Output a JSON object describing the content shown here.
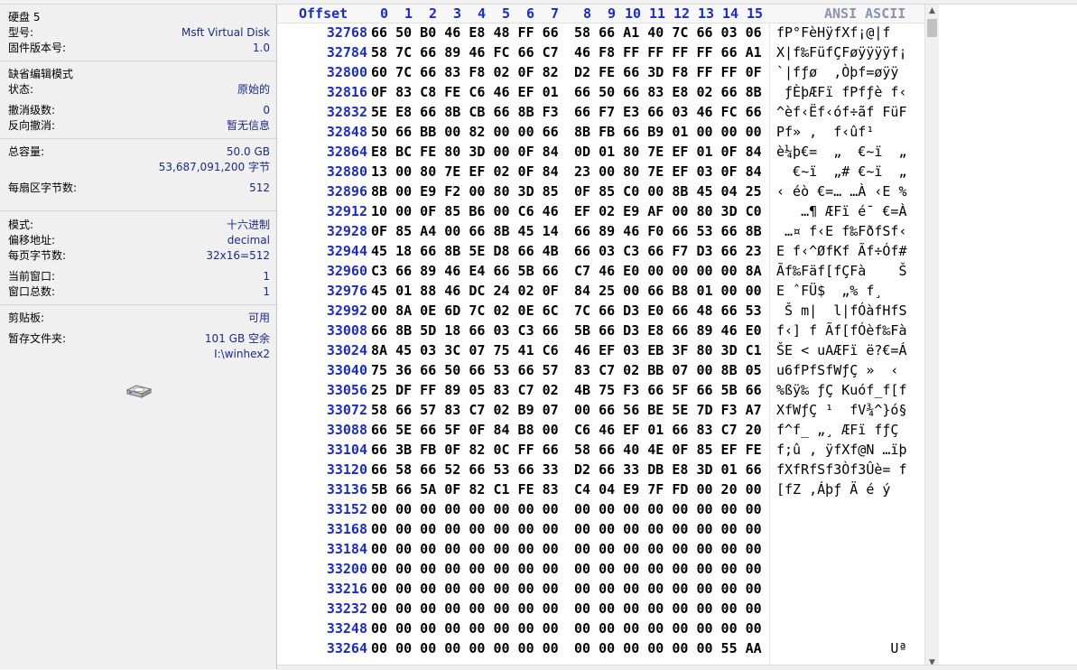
{
  "panel": {
    "disk": {
      "label": "硬盘 5"
    },
    "model": {
      "label": "型号:",
      "value": "Msft Virtual Disk"
    },
    "firmware": {
      "label": "固件版本号:",
      "value": "1.0"
    },
    "default_edit_mode": {
      "label": "缺省编辑模式"
    },
    "state": {
      "label": "状态:",
      "value": "原始的"
    },
    "undo_level": {
      "label": "撤消级数:",
      "value": "0"
    },
    "reverse_undo": {
      "label": "反向撤消:",
      "value": "暂无信息"
    },
    "capacity": {
      "label": "总容量:",
      "value": "50.0 GB",
      "value2": "53,687,091,200 字节"
    },
    "bytes_per_sector": {
      "label": "每扇区字节数:",
      "value": "512"
    },
    "mode": {
      "label": "模式:",
      "value": "十六进制"
    },
    "offset_addr": {
      "label": "偏移地址:",
      "value": "decimal"
    },
    "bytes_per_page": {
      "label": "每页字节数:",
      "value": "32x16=512"
    },
    "current_window": {
      "label": "当前窗口:",
      "value": "1"
    },
    "window_total": {
      "label": "窗口总数:",
      "value": "1"
    },
    "clipboard": {
      "label": "剪贴板:",
      "value": "可用"
    },
    "temp_folder": {
      "label": "暂存文件夹:",
      "value": "101 GB 空余",
      "value2": "I:\\winhex2"
    }
  },
  "hex": {
    "header": {
      "offset": "Offset",
      "cols": [
        "0",
        "1",
        "2",
        "3",
        "4",
        "5",
        "6",
        "7",
        "8",
        "9",
        "10",
        "11",
        "12",
        "13",
        "14",
        "15"
      ],
      "ascii": "ANSI ASCII"
    },
    "rows": [
      {
        "offset": "32768",
        "b1": "66 50 B0 46 E8 48 FF 66",
        "b2": "58 66 A1 40 7C 66 03 06",
        "ascii": "fP°FèHÿfXf¡@|f  "
      },
      {
        "offset": "32784",
        "b1": "58 7C 66 89 46 FC 66 C7",
        "b2": "46 F8 FF FF FF FF 66 A1",
        "ascii": "X|f‰FüfÇFøÿÿÿÿf¡"
      },
      {
        "offset": "32800",
        "b1": "60 7C 66 83 F8 02 0F 82",
        "b2": "D2 FE 66 3D F8 FF FF 0F",
        "ascii": "`|fƒø  ‚Òþf=øÿÿ "
      },
      {
        "offset": "32816",
        "b1": "0F 83 C8 FE C6 46 EF 01",
        "b2": "66 50 66 83 E8 02 66 8B",
        "ascii": " ƒÈþÆFï fPfƒè f‹"
      },
      {
        "offset": "32832",
        "b1": "5E E8 66 8B CB 66 8B F3",
        "b2": "66 F7 E3 66 03 46 FC 66",
        "ascii": "^èf‹Ëf‹óf÷ãf FüF"
      },
      {
        "offset": "32848",
        "b1": "50 66 BB 00 82 00 00 66",
        "b2": "8B FB 66 B9 01 00 00 00",
        "ascii": "Pf» ‚  f‹ûf¹    "
      },
      {
        "offset": "32864",
        "b1": "E8 BC FE 80 3D 00 0F 84",
        "b2": "0D 01 80 7E EF 01 0F 84",
        "ascii": "è¼þ€=  „  €~ï  „"
      },
      {
        "offset": "32880",
        "b1": "13 00 80 7E EF 02 0F 84",
        "b2": "23 00 80 7E EF 03 0F 84",
        "ascii": "  €~ï  „# €~ï  „"
      },
      {
        "offset": "32896",
        "b1": "8B 00 E9 F2 00 80 3D 85",
        "b2": "0F 85 C0 00 8B 45 04 25",
        "ascii": "‹ éò €=… …À ‹E %"
      },
      {
        "offset": "32912",
        "b1": "10 00 0F 85 B6 00 C6 46",
        "b2": "EF 02 E9 AF 00 80 3D C0",
        "ascii": "   …¶ ÆFï é¯ €=À"
      },
      {
        "offset": "32928",
        "b1": "0F 85 A4 00 66 8B 45 14",
        "b2": "66 89 46 F0 66 53 66 8B",
        "ascii": " …¤ f‹E f‰FðfSf‹"
      },
      {
        "offset": "32944",
        "b1": "45 18 66 8B 5E D8 66 4B",
        "b2": "66 03 C3 66 F7 D3 66 23",
        "ascii": "E f‹^ØfKf Ãf÷Óf#"
      },
      {
        "offset": "32960",
        "b1": "C3 66 89 46 E4 66 5B 66",
        "b2": "C7 46 E0 00 00 00 00 8A",
        "ascii": "Ãf‰Fäf[fÇFà    Š"
      },
      {
        "offset": "32976",
        "b1": "45 01 88 46 DC 24 02 0F",
        "b2": "84 25 00 66 B8 01 00 00",
        "ascii": "E ˆFÜ$  „% f¸   "
      },
      {
        "offset": "32992",
        "b1": "00 8A 0E 6D 7C 02 0E 6C",
        "b2": "7C 66 D3 E0 66 48 66 53",
        "ascii": " Š m|  l|fÓàfHfS"
      },
      {
        "offset": "33008",
        "b1": "66 8B 5D 18 66 03 C3 66",
        "b2": "5B 66 D3 E8 66 89 46 E0",
        "ascii": "f‹] f Ãf[fÓèf‰Fà"
      },
      {
        "offset": "33024",
        "b1": "8A 45 03 3C 07 75 41 C6",
        "b2": "46 EF 03 EB 3F 80 3D C1",
        "ascii": "ŠE < uAÆFï ë?€=Á"
      },
      {
        "offset": "33040",
        "b1": "75 36 66 50 66 53 66 57",
        "b2": "83 C7 02 BB 07 00 8B 05",
        "ascii": "u6fPfSfWƒÇ »  ‹ "
      },
      {
        "offset": "33056",
        "b1": "25 DF FF 89 05 83 C7 02",
        "b2": "4B 75 F3 66 5F 66 5B 66",
        "ascii": "%ßÿ‰ ƒÇ Kuóf_f[f"
      },
      {
        "offset": "33072",
        "b1": "58 66 57 83 C7 02 B9 07",
        "b2": "00 66 56 BE 5E 7D F3 A7",
        "ascii": "XfWƒÇ ¹  fV¾^}ó§"
      },
      {
        "offset": "33088",
        "b1": "66 5E 66 5F 0F 84 B8 00",
        "b2": "C6 46 EF 01 66 83 C7 20",
        "ascii": "f^f_ „¸ ÆFï fƒÇ "
      },
      {
        "offset": "33104",
        "b1": "66 3B FB 0F 82 0C FF 66",
        "b2": "58 66 40 4E 0F 85 EF FE",
        "ascii": "f;û ‚ ÿfXf@N …ïþ"
      },
      {
        "offset": "33120",
        "b1": "66 58 66 52 66 53 66 33",
        "b2": "D2 66 33 DB E8 3D 01 66",
        "ascii": "fXfRfSf3Òf3Ûè= f"
      },
      {
        "offset": "33136",
        "b1": "5B 66 5A 0F 82 C1 FE 83",
        "b2": "C4 04 E9 7F FD 00 20 00",
        "ascii": "[fZ ‚Áþƒ Ä é ý   "
      },
      {
        "offset": "33152",
        "b1": "00 00 00 00 00 00 00 00",
        "b2": "00 00 00 00 00 00 00 00",
        "ascii": ""
      },
      {
        "offset": "33168",
        "b1": "00 00 00 00 00 00 00 00",
        "b2": "00 00 00 00 00 00 00 00",
        "ascii": ""
      },
      {
        "offset": "33184",
        "b1": "00 00 00 00 00 00 00 00",
        "b2": "00 00 00 00 00 00 00 00",
        "ascii": ""
      },
      {
        "offset": "33200",
        "b1": "00 00 00 00 00 00 00 00",
        "b2": "00 00 00 00 00 00 00 00",
        "ascii": ""
      },
      {
        "offset": "33216",
        "b1": "00 00 00 00 00 00 00 00",
        "b2": "00 00 00 00 00 00 00 00",
        "ascii": ""
      },
      {
        "offset": "33232",
        "b1": "00 00 00 00 00 00 00 00",
        "b2": "00 00 00 00 00 00 00 00",
        "ascii": ""
      },
      {
        "offset": "33248",
        "b1": "00 00 00 00 00 00 00 00",
        "b2": "00 00 00 00 00 00 00 00",
        "ascii": ""
      },
      {
        "offset": "33264",
        "b1": "00 00 00 00 00 00 00 00",
        "b2": "00 00 00 00 00 00 55 AA",
        "ascii": "              Uª"
      }
    ]
  },
  "colors": {
    "offset_blue": "#1a2bd0",
    "panel_value": "#1a2a8c",
    "panel_bg": "#f0f0f0"
  },
  "icons": {
    "disk": "hard-disk-icon"
  }
}
